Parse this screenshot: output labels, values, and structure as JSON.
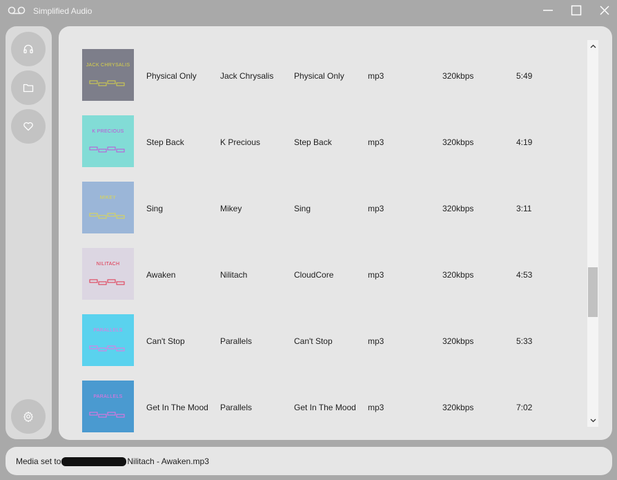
{
  "window": {
    "title": "Simplified Audio",
    "app_icon": "voicemail-icon",
    "controls": [
      "minimize-icon",
      "maximize-icon",
      "close-icon"
    ]
  },
  "sidebar": {
    "items": [
      {
        "name": "now-playing",
        "icon": "headphones-icon"
      },
      {
        "name": "library",
        "icon": "folder-icon"
      },
      {
        "name": "favorites",
        "icon": "heart-icon"
      }
    ],
    "settings_icon": "gear-icon"
  },
  "songs": [
    {
      "title": "Physical Only",
      "artist": "Jack Chrysalis",
      "album": "Physical Only",
      "format": "mp3",
      "bitrate": "320kbps",
      "duration": "5:49",
      "cover_text": "JACK CHRYSALIS",
      "cover_bg": "#7d7e8a",
      "cover_accent": "#d8d24a"
    },
    {
      "title": "Step Back",
      "artist": "K Precious",
      "album": "Step Back",
      "format": "mp3",
      "bitrate": "320kbps",
      "duration": "4:19",
      "cover_text": "K PRECIOUS",
      "cover_bg": "#82dcd6",
      "cover_accent": "#c050d8"
    },
    {
      "title": "Sing",
      "artist": "Mikey",
      "album": "Sing",
      "format": "mp3",
      "bitrate": "320kbps",
      "duration": "3:11",
      "cover_text": "MIKEY",
      "cover_bg": "#9bb6d8",
      "cover_accent": "#e0d84a"
    },
    {
      "title": "Awaken",
      "artist": "Nilitach",
      "album": "CloudCore",
      "format": "mp3",
      "bitrate": "320kbps",
      "duration": "4:53",
      "cover_text": "NILITACH",
      "cover_bg": "#dcd6e2",
      "cover_accent": "#e0304a"
    },
    {
      "title": "Can't Stop",
      "artist": "Parallels",
      "album": "Can't Stop",
      "format": "mp3",
      "bitrate": "320kbps",
      "duration": "5:33",
      "cover_text": "PARALLELS",
      "cover_bg": "#5ad2ee",
      "cover_accent": "#f070e0"
    },
    {
      "title": "Get In The Mood",
      "artist": "Parallels",
      "album": "Get In The Mood",
      "format": "mp3",
      "bitrate": "320kbps",
      "duration": "7:02",
      "cover_text": "PARALLELS",
      "cover_bg": "#4a9ad0",
      "cover_accent": "#f070e0"
    }
  ],
  "status": {
    "prefix": "Media set to ",
    "suffix": "Nilitach - Awaken.mp3"
  }
}
